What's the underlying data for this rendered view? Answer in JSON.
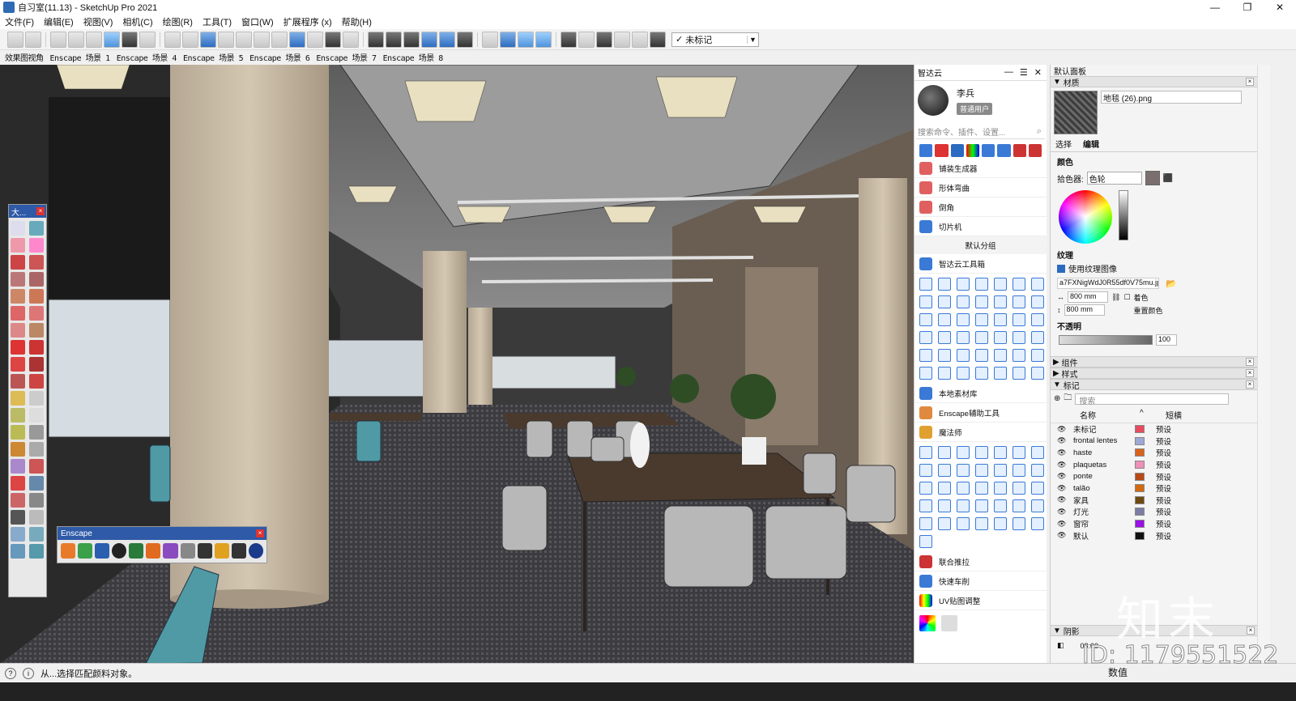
{
  "window": {
    "title": "自习室(11.13) - SketchUp Pro 2021",
    "controls": [
      "—",
      "❐",
      "✕"
    ]
  },
  "menu": [
    "文件(F)",
    "编辑(E)",
    "视图(V)",
    "相机(C)",
    "绘图(R)",
    "工具(T)",
    "窗口(W)",
    "扩展程序 (x)",
    "帮助(H)"
  ],
  "toolbar": {
    "tag_value": "未标记",
    "tag_check": "✓"
  },
  "scenes": [
    "效果图视角",
    "Enscape 场景 1",
    "Enscape 场景 4",
    "Enscape 场景 5",
    "Enscape 场景 6",
    "Enscape 场景 7",
    "Enscape 场景 8"
  ],
  "left_toolbar": {
    "title": "大..."
  },
  "enscape": {
    "title": "Enscape"
  },
  "zhidayun": {
    "title": "智达云",
    "user_name": "李兵",
    "user_badge": "普通用户",
    "search_placeholder": "搜索命令、插件、设置...",
    "items_top": [
      "铺装生成器",
      "形体弯曲",
      "倒角",
      "切片机"
    ],
    "group_label": "默认分组",
    "toolbox_label": "智达云工具箱",
    "items_mid": [
      "本地素材库",
      "Enscape辅助工具",
      "魔法师"
    ],
    "items_bottom": [
      "联合推拉",
      "快速车削",
      "UV贴图调整"
    ]
  },
  "tray": {
    "title": "默认面板",
    "materials_header": "材质",
    "material_name": "地毯 (26).png",
    "tab_select": "选择",
    "tab_edit": "编辑",
    "color_label": "颜色",
    "picker_label": "拾色器:",
    "picker_value": "色轮",
    "texture_label": "纹理",
    "use_texture": "使用纹理图像",
    "texture_path": "a7FXNigWdJ0R55df0V75mu.jpg",
    "width": "800 mm",
    "height": "800 mm",
    "colorize": "着色",
    "reset_color": "重置颜色",
    "opacity_label": "不透明",
    "opacity_value": "100",
    "components_header": "组件",
    "styles_header": "样式",
    "tags_header": "标记",
    "tags_search": "搜索",
    "col_name": "名称",
    "col_dash": "短横",
    "tags": [
      {
        "name": "未标记",
        "color": "#e84a5f",
        "dash": "预设"
      },
      {
        "name": "frontal lentes",
        "color": "#9ea8d8",
        "dash": "预设"
      },
      {
        "name": "haste",
        "color": "#d9631a",
        "dash": "预设"
      },
      {
        "name": "plaquetas",
        "color": "#f090b8",
        "dash": "预设"
      },
      {
        "name": "ponte",
        "color": "#b84a14",
        "dash": "预设"
      },
      {
        "name": "talão",
        "color": "#d46a10",
        "dash": "预设"
      },
      {
        "name": "家具",
        "color": "#6e4a12",
        "dash": "预设"
      },
      {
        "name": "灯光",
        "color": "#7c7ca6",
        "dash": "预设"
      },
      {
        "name": "窗帘",
        "color": "#9a10e6",
        "dash": "预设"
      },
      {
        "name": "默认",
        "color": "#111111",
        "dash": "预设"
      }
    ],
    "shadows_header": "阴影",
    "shadow_time": "08:00"
  },
  "status": {
    "message": "从...选择匹配颜料对象。",
    "value_label": "数值"
  },
  "overlay": {
    "watermark": "知末",
    "id_text": "ID: 1179551522"
  }
}
